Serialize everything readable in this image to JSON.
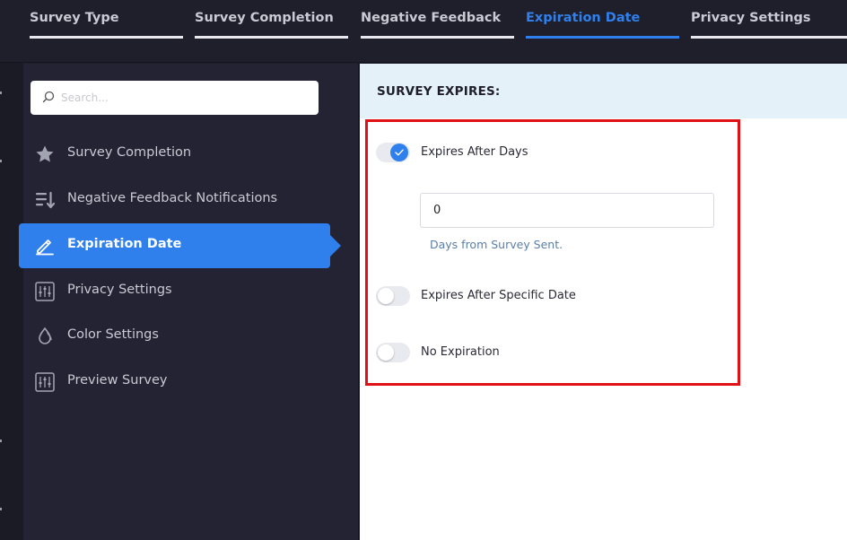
{
  "tabs": [
    {
      "label": "Survey Type",
      "active": false
    },
    {
      "label": "Survey Completion",
      "active": false
    },
    {
      "label": "Negative Feedback",
      "active": false
    },
    {
      "label": "Expiration Date",
      "active": true
    },
    {
      "label": "Privacy Settings",
      "active": false
    }
  ],
  "search": {
    "placeholder": "Search..."
  },
  "sidebar": {
    "items": [
      {
        "label": "Survey Completion",
        "icon": "star-icon"
      },
      {
        "label": "Negative Feedback Notifications",
        "icon": "sort-list-icon"
      },
      {
        "label": "Expiration Date",
        "icon": "pencil-icon",
        "active": true
      },
      {
        "label": "Privacy Settings",
        "icon": "sliders-icon"
      },
      {
        "label": "Color Settings",
        "icon": "droplet-icon"
      },
      {
        "label": "Preview Survey",
        "icon": "sliders-icon"
      }
    ]
  },
  "main": {
    "section_title": "SURVEY EXPIRES:",
    "options": [
      {
        "label": "Expires After Days",
        "checked": true
      },
      {
        "label": "Expires After Specific Date",
        "checked": false
      },
      {
        "label": "No Expiration",
        "checked": false
      }
    ],
    "days_value": "0",
    "days_hint": "Days from Survey Sent."
  },
  "colors": {
    "accent": "#2f80ed",
    "sidebar_bg": "#242333",
    "highlight_border": "#e01015",
    "header_bg": "#e5f1f8"
  }
}
